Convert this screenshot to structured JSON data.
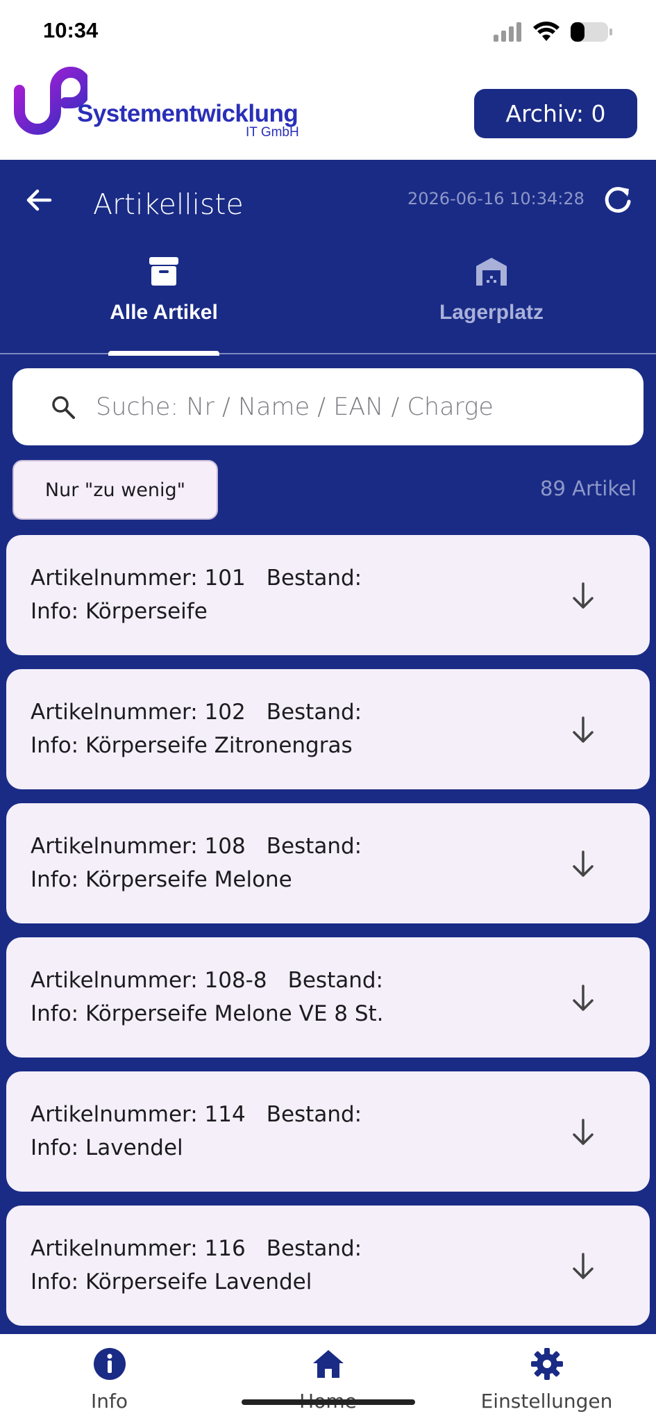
{
  "status_bar": {
    "time": "10:34"
  },
  "header": {
    "logo_text": "Systementwicklung",
    "logo_sub": "IT GmbH",
    "archiv_label": "Archiv: 0"
  },
  "toolbar": {
    "title": "Artikelliste",
    "timestamp": "2026-06-16 10:34:28"
  },
  "tabs": [
    {
      "label": "Alle Artikel",
      "active": true,
      "icon": "archive-box-icon"
    },
    {
      "label": "Lagerplatz",
      "active": false,
      "icon": "warehouse-icon"
    }
  ],
  "search": {
    "placeholder": "Suche: Nr / Name / EAN / Charge",
    "value": ""
  },
  "filter": {
    "label": "Nur \"zu wenig\""
  },
  "article_count": "89 Artikel",
  "articles": [
    {
      "nummer": "Artikelnummer: 101",
      "bestand": "Bestand:",
      "info": "Info: Körperseife"
    },
    {
      "nummer": "Artikelnummer: 102",
      "bestand": "Bestand:",
      "info": "Info: Körperseife Zitronengras"
    },
    {
      "nummer": "Artikelnummer: 108",
      "bestand": "Bestand:",
      "info": "Info: Körperseife Melone"
    },
    {
      "nummer": "Artikelnummer: 108-8",
      "bestand": "Bestand:",
      "info": "Info: Körperseife Melone VE 8 St."
    },
    {
      "nummer": "Artikelnummer: 114",
      "bestand": "Bestand:",
      "info": "Info: Lavendel"
    },
    {
      "nummer": "Artikelnummer: 116",
      "bestand": "Bestand:",
      "info": "Info: Körperseife Lavendel"
    }
  ],
  "bottom_nav": [
    {
      "label": "Info",
      "icon": "info-icon"
    },
    {
      "label": "Home",
      "icon": "home-icon"
    },
    {
      "label": "Einstellungen",
      "icon": "gear-icon"
    }
  ],
  "colors": {
    "primary": "#1a2b86",
    "card": "#f4eff8",
    "logo": "#2a2fb8"
  }
}
